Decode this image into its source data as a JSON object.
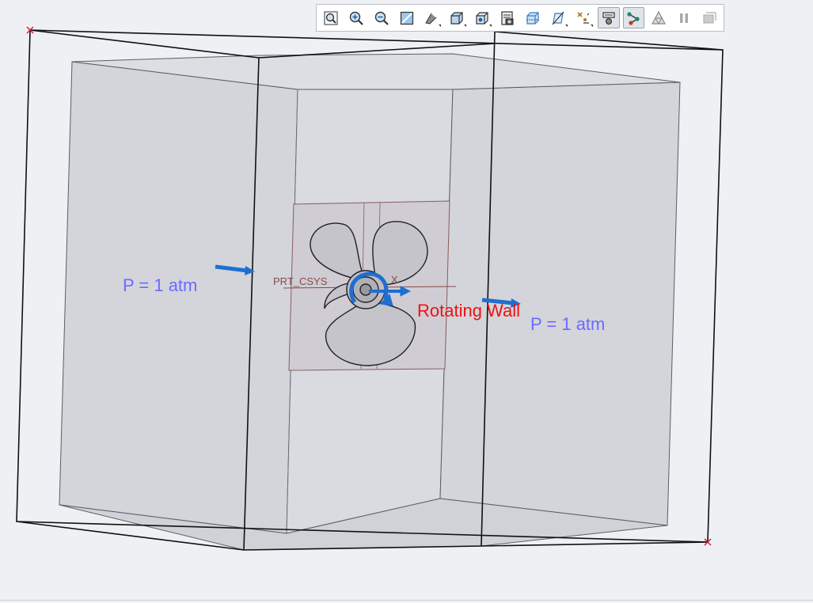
{
  "viewport": {
    "labels": {
      "pressure_left": "P = 1 atm",
      "pressure_right": "P = 1 atm",
      "rotating_wall": "Rotating Wall",
      "csys": "PRT_CSYS",
      "axis_x": "X"
    },
    "colors": {
      "background": "#eef0f3",
      "box_face": "#d6d8de",
      "edge": "#111111",
      "arrow": "#1e6fd0",
      "pressure_label": "#6b6bff",
      "rotating_label": "#ee1111",
      "csys": "#8a4a4a"
    }
  },
  "toolbar": {
    "buttons": [
      {
        "id": "refit",
        "icon": "zoom-fit-icon"
      },
      {
        "id": "zoom_in",
        "icon": "zoom-in-icon"
      },
      {
        "id": "zoom_out",
        "icon": "zoom-out-icon"
      },
      {
        "id": "repaint",
        "icon": "repaint-icon"
      },
      {
        "id": "perspective",
        "icon": "perspective-icon"
      },
      {
        "id": "display_style",
        "icon": "display-style-icon"
      },
      {
        "id": "saved_views",
        "icon": "saved-views-icon"
      },
      {
        "id": "view_manager",
        "icon": "view-manager-icon"
      },
      {
        "id": "section",
        "icon": "section-icon"
      },
      {
        "id": "datum_display",
        "icon": "datum-display-icon"
      },
      {
        "id": "annotation_display",
        "icon": "annotation-display-icon"
      },
      {
        "id": "spin_center",
        "icon": "spin-center-icon",
        "active": true
      },
      {
        "id": "connection",
        "icon": "connection-icon",
        "active": true
      },
      {
        "id": "mesh",
        "icon": "mesh-icon"
      },
      {
        "id": "pause",
        "icon": "pause-icon"
      },
      {
        "id": "stop",
        "icon": "stop-icon"
      }
    ]
  }
}
